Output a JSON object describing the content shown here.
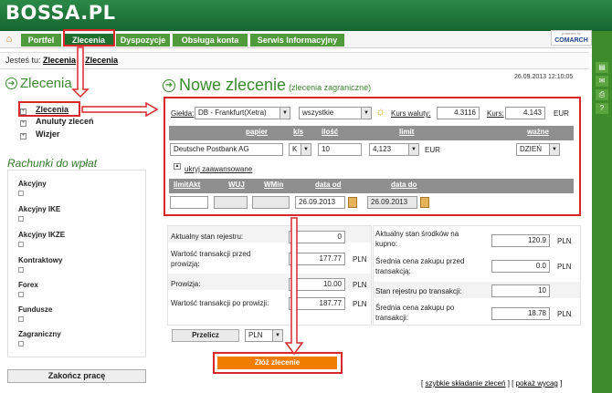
{
  "app": {
    "logo": "BOSSA.PL",
    "powered": "powered by",
    "vendor": "COMARCH"
  },
  "nav": {
    "tabs": [
      "Portfel",
      "Zlecenia",
      "Dyspozycje",
      "Obsługa konta",
      "Serwis Informacyjny"
    ],
    "active": "Zlecenia"
  },
  "breadcrumb": {
    "prefix": "Jesteś tu:",
    "items": [
      "Zlecenia",
      "Zlecenia"
    ],
    "sep": "»"
  },
  "datetime": "26.09.2013 12:10:05",
  "left_nav": {
    "title": "Zlecenia",
    "items": [
      "Zlecenia",
      "Anuluty zleceń",
      "Wizjer"
    ]
  },
  "accounts": {
    "title": "Rachunki do wpłat",
    "items": [
      "Akcyjny",
      "Akcyjny IKE",
      "Akcyjny IKZE",
      "Kontraktowy",
      "Forex",
      "Fundusze",
      "Zagraniczny"
    ]
  },
  "logout": "Zakończ pracę",
  "page": {
    "title": "Nowe zlecenie",
    "subtitle": "(zlecenia zagraniczne)"
  },
  "order": {
    "gielda_label": "Giełda:",
    "gielda": "DB - Frankfurt(Xetra)",
    "filter": "wszystkie",
    "kurs_walut_label": "Kurs waluty:",
    "kurs_walut": "4.3116",
    "kurs_label": "Kurs:",
    "kurs": "4.143",
    "kurs_cur": "EUR",
    "headers": {
      "papier": "papier",
      "ks": "k/s",
      "ilosc": "ilość",
      "limit": "limit",
      "wazne": "ważne"
    },
    "papier": "Deutsche Postbank AG",
    "ks": "K",
    "ilosc": "10",
    "limit": "4,123",
    "limit_cur": "EUR",
    "wazne": "DZIEŃ",
    "advanced_link": "ukryj zaawansowane",
    "adv_headers": {
      "limitakt": "limitAkt",
      "wuj": "WUJ",
      "wmin": "WMin",
      "data_od": "data od",
      "data_do": "data do"
    },
    "data_od": "26.09.2013",
    "data_do": "26.09.2013"
  },
  "summary": {
    "left": [
      {
        "label": "Aktualny stan rejestru:",
        "value": "0",
        "cur": ""
      },
      {
        "label": "Wartość transakcji przed prowizją:",
        "value": "177.77",
        "cur": "PLN"
      },
      {
        "label": "Prowizja:",
        "value": "10.00",
        "cur": "PLN"
      },
      {
        "label": "Wartość transakcji po prowizji:",
        "value": "187.77",
        "cur": "PLN"
      }
    ],
    "right": [
      {
        "label": "Aktualny stan środków na kupno:",
        "value": "120.9",
        "cur": "PLN"
      },
      {
        "label": "Średnia cena zakupu przed transakcją:",
        "value": "0.0",
        "cur": "PLN"
      },
      {
        "label": "Stan rejestru po transakcji:",
        "value": "10",
        "cur": ""
      },
      {
        "label": "Średnia cena zakupu po transakcji:",
        "value": "18.78",
        "cur": "PLN"
      }
    ],
    "recalc": "Przelicz",
    "currency": "PLN"
  },
  "submit": "Złóż zlecenie",
  "links": {
    "fast": "szybkie składanie zleceń",
    "preview": "pokaż wycag"
  }
}
